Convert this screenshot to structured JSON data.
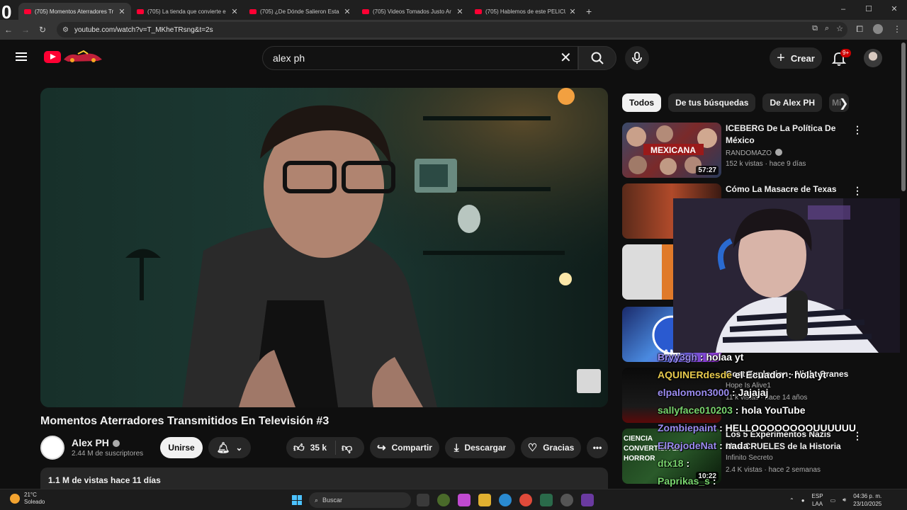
{
  "browser": {
    "profile_glyph": "0",
    "tabs": [
      {
        "title": "(705) Momentos Aterradores Tr"
      },
      {
        "title": "(705) La tienda que convierte e"
      },
      {
        "title": "(705) ¿De Dónde Salieron Esta"
      },
      {
        "title": "(705) Videos Tomados Justo Ar"
      },
      {
        "title": "(705) Hablemos de este PELICU"
      }
    ],
    "tab_close": "✕",
    "new_tab": "+",
    "url": "youtube.com/watch?v=T_MKheTRsng&t=2s",
    "window_controls": [
      "–",
      "☐",
      "✕"
    ]
  },
  "youtube": {
    "search_value": "alex ph",
    "create_label": "Crear",
    "notif_count": "9+",
    "video": {
      "title": "Momentos Aterradores Transmitidos En Televisión #3",
      "channel": "Alex PH",
      "subscribers": "2.44 M de suscriptores",
      "join_label": "Unirse",
      "likes": "35 k",
      "share_label": "Compartir",
      "download_label": "Descargar",
      "thanks_label": "Gracias",
      "stats": "1.1 M de vistas  hace 11 días"
    },
    "chips": [
      {
        "label": "Todos"
      },
      {
        "label": "De tus búsquedas"
      },
      {
        "label": "De Alex PH"
      },
      {
        "label": "Mi"
      }
    ],
    "recommendations": [
      {
        "title": "ICEBERG De La Política De México",
        "channel": "RANDOMAZO",
        "meta": "152 k vistas · hace 9 días",
        "duration": "57:27"
      },
      {
        "title": "Cómo La Masacre de Texas",
        "channel": "",
        "meta": "",
        "duration": ""
      },
      {
        "title": "",
        "channel": "",
        "meta": "",
        "duration": ""
      },
      {
        "title": "",
        "channel": "",
        "meta": "",
        "duration": ""
      },
      {
        "title": "Goat Explosion - Night Cranes",
        "channel": "Hope Is Alive1",
        "meta": "11 k vistas · hace 14 años",
        "duration": ""
      },
      {
        "title": "Los 5 Experimentos Nazis Mas CRUELES de la Historia",
        "channel": "Infinito Secreto",
        "meta": "2.4 K vistas · hace 2 semanas",
        "duration": "10:22"
      }
    ],
    "thumb_text": {
      "iceberg": "MEXICANA",
      "nazi": "CIENCIA CONVERTIDA EN HORROR",
      "amb": "AMI"
    }
  },
  "chat": [
    {
      "user": "Bryy3gh",
      "msg": ": holaa yt"
    },
    {
      "user": "AQUINERdesde",
      "msg": "el Ecuador : hola yt"
    },
    {
      "user": "elpalomon3000",
      "msg": ": Jajajaj"
    },
    {
      "user": "sallyface010203",
      "msg": ": hola YouTube"
    },
    {
      "user": "Zombiepaint",
      "msg": ": HELLOOOOOOOOUUUUUU"
    },
    {
      "user": "ElRojodeNat",
      "msg": ": nada"
    },
    {
      "user": "dtx18",
      "msg": ": "
    },
    {
      "user": "Paprikas_s",
      "msg": ": "
    }
  ],
  "taskbar": {
    "temp": "21°C",
    "weather": "Soleado",
    "search_placeholder": "Buscar",
    "lang_top": "ESP",
    "lang_bottom": "LAA",
    "time": "04:36 p. m.",
    "date": "23/10/2025"
  },
  "colors": {
    "yt_red": "#ff0033",
    "background": "#0f0f0f",
    "chip_bg": "#272727"
  },
  "icons": [
    "menu-icon",
    "youtube-logo",
    "search-icon",
    "close-icon",
    "mic-icon",
    "plus-icon",
    "bell-icon",
    "like-icon",
    "dislike-icon",
    "share-icon",
    "download-icon",
    "thanks-icon",
    "more-icon",
    "kebab-icon",
    "chevron-right-icon"
  ]
}
